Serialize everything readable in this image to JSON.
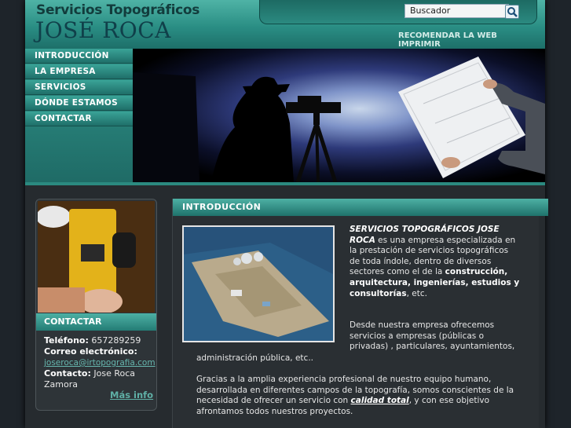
{
  "brand": {
    "line1": "Servicios Topográficos",
    "line2": "JOSÉ ROCA"
  },
  "search": {
    "placeholder": "Buscador",
    "value": "Buscador"
  },
  "toplinks": [
    "RECOMENDAR LA WEB",
    "IMPRIMIR"
  ],
  "nav": [
    "INTRODUCCIÓN",
    "LA EMPRESA",
    "SERVICIOS",
    "DÓNDE ESTAMOS",
    "CONTACTAR"
  ],
  "contact": {
    "heading": "CONTACTAR",
    "phone_label": "Teléfono:",
    "phone": "657289259",
    "email_label": "Correo electrónico:",
    "email": "joseroca@irtopografia.com",
    "contact_label": "Contacto:",
    "contact_name": "Jose Roca Zamora",
    "more": "Más info"
  },
  "main": {
    "heading": "INTRODUCCIÓN",
    "lead": "SERVICIOS TOPOGRÁFICOS JOSE ROCA",
    "p1_a": " es una empresa especializada en la prestación de servicios topográficos de toda índole, dentro de diversos sectores como el de la ",
    "p1_bold": "construcción, arquitectura, ingenierías, estudios y consultorías",
    "p1_c": ", etc.",
    "p2": "Desde nuestra empresa ofrecemos servicios a empresas (públicas o privadas) , particulares, ayuntamientos,",
    "p2b": "administración pública, etc..",
    "p3_a": "Gracias a la amplia experiencia profesional de nuestro equipo humano, desarrollada en diferentes campos de la topografía, somos conscientes de la necesidad de ofrecer un servicio con ",
    "p3_hl": "calidad total",
    "p3_c": ", y con ese objetivo afrontamos todos nuestros proyectos."
  }
}
